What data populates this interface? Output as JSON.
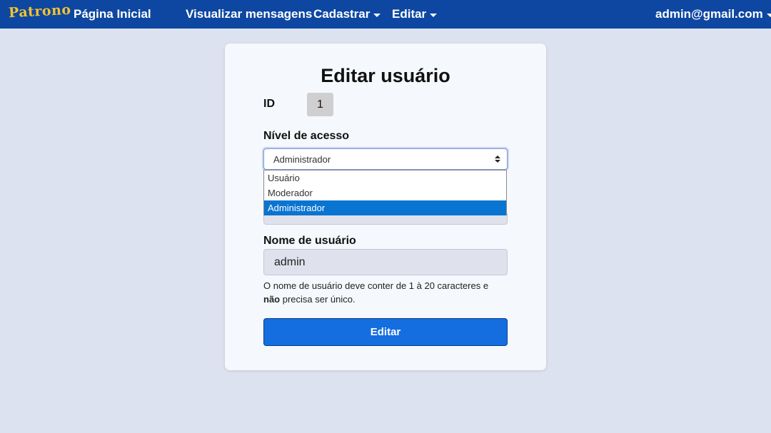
{
  "navbar": {
    "brand": "Patrono",
    "home": "Página Inicial",
    "messages": "Visualizar mensagens",
    "register": "Cadastrar",
    "edit": "Editar",
    "user": "admin@gmail.com"
  },
  "form": {
    "title": "Editar usuário",
    "id_label": "ID",
    "id_value": "1",
    "access_label": "Nível de acesso",
    "access_selected": "Administrador",
    "access_options": [
      "Usuário",
      "Moderador",
      "Administrador"
    ],
    "username_label": "Nome de usuário",
    "username_value": "admin",
    "help_part1": "O nome de usuário deve conter de 1 à 20 caracteres e ",
    "help_bold": "não",
    "help_part2": " precisa ser único.",
    "submit": "Editar"
  },
  "colors": {
    "navbar": "#0d47a1",
    "brand": "#f2c230",
    "background": "#dde2f0",
    "button": "#146ee0",
    "option_selected": "#0a74d1"
  }
}
